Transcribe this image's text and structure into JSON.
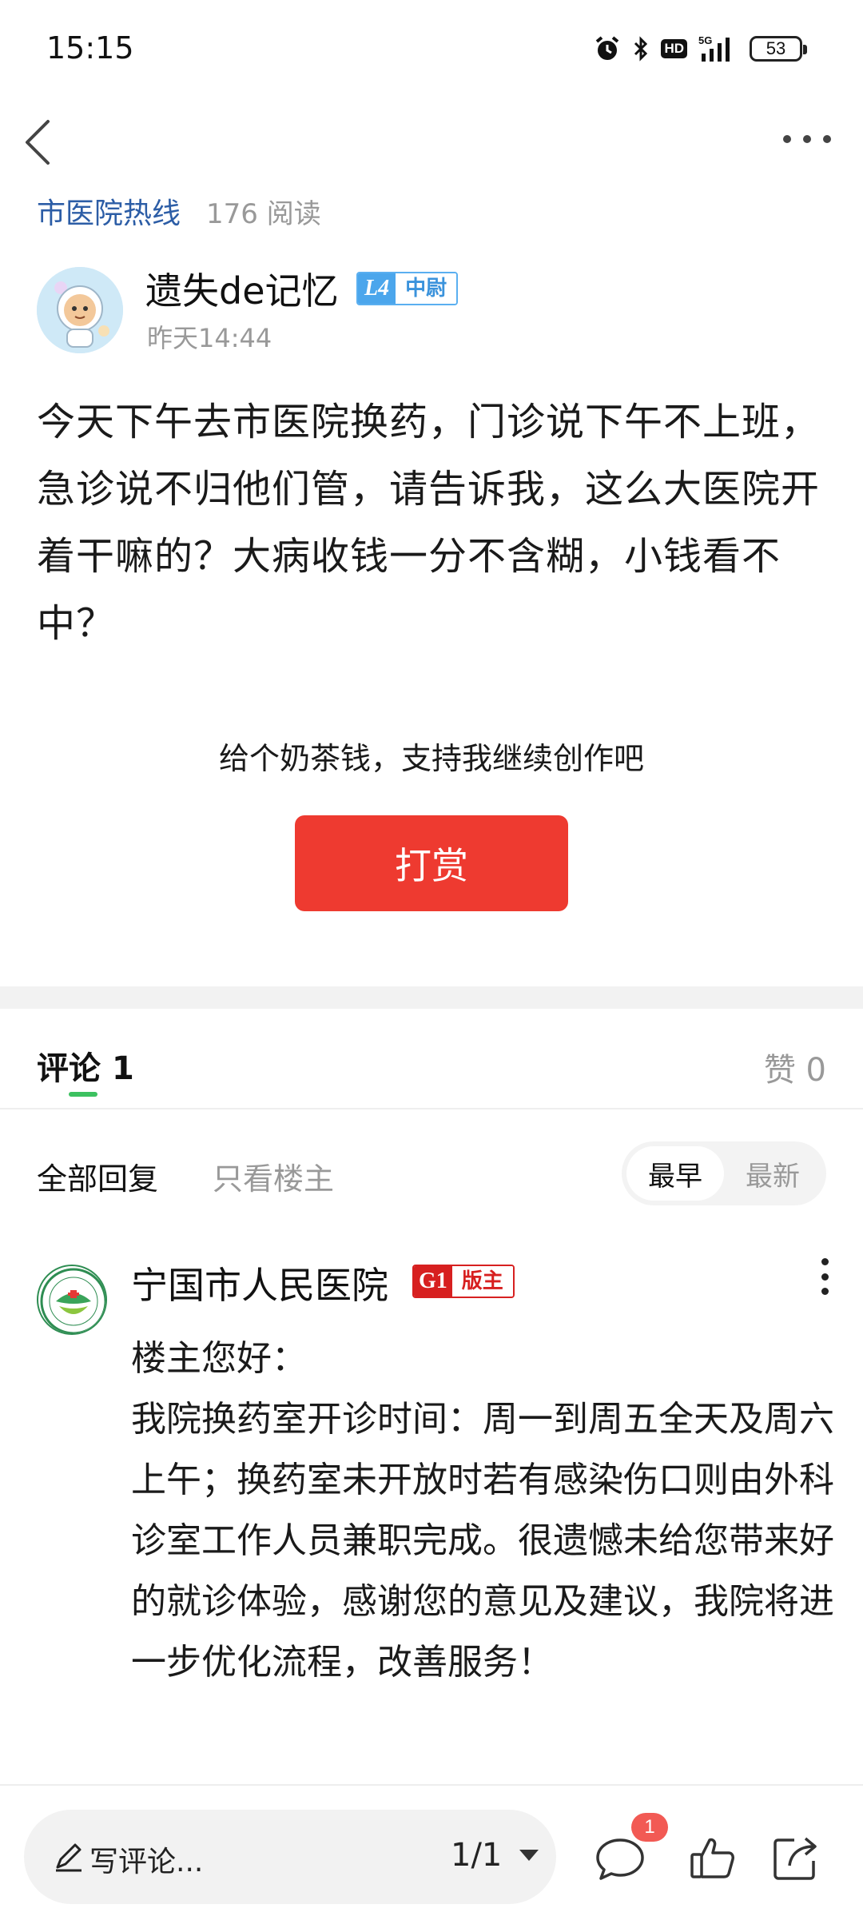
{
  "status_bar": {
    "time": "15:15",
    "network": "5G",
    "hd_label": "HD",
    "battery": "53",
    "icons": [
      "alarm-icon",
      "bluetooth-icon",
      "hd-icon",
      "signal-icon",
      "battery-icon"
    ]
  },
  "nav": {
    "back_icon": "chevron-left-icon",
    "more_icon": "more-horizontal-icon"
  },
  "post": {
    "forum_name": "市医院热线",
    "read_count": "176 阅读",
    "author": {
      "name": "遗失de记忆",
      "level": "L4",
      "rank": "中尉",
      "time": "昨天14:44"
    },
    "body": "今天下午去市医院换药，门诊说下午不上班，急诊说不归他们管，请告诉我，这么大医院开着干嘛的？大病收钱一分不含糊，小钱看不中？"
  },
  "reward": {
    "prompt": "给个奶茶钱，支持我继续创作吧",
    "button_label": "打赏"
  },
  "comments_header": {
    "comment_label": "评论",
    "comment_count": "1",
    "like_label": "赞",
    "like_count": "0"
  },
  "filters": {
    "all_replies": "全部回复",
    "owner_only": "只看楼主",
    "sort_earliest": "最早",
    "sort_newest": "最新"
  },
  "comment": {
    "author": "宁国市人民医院",
    "badge_level": "G1",
    "badge_role": "版主",
    "lines": [
      "楼主您好：",
      "我院换药室开诊时间：周一到周五全天及周六上午；换药室未开放时若有感染伤口则由外科诊室工作人员兼职完成。很遗憾未给您带来好的就诊体验，感谢您的意见及建议，我院将进一步优化流程，改善服务！"
    ]
  },
  "bottom_bar": {
    "input_placeholder": "写评论...",
    "page_indicator": "1/1",
    "notification_count": "1",
    "icons": [
      "pencil-icon",
      "comment-icon",
      "thumbs-up-icon",
      "share-icon"
    ]
  },
  "colors": {
    "accent_red": "#ee3a30",
    "forum_blue": "#2c5da6",
    "tab_green": "#3cc160",
    "level_blue": "#4ba6ec",
    "moderator_red": "#d72020"
  }
}
